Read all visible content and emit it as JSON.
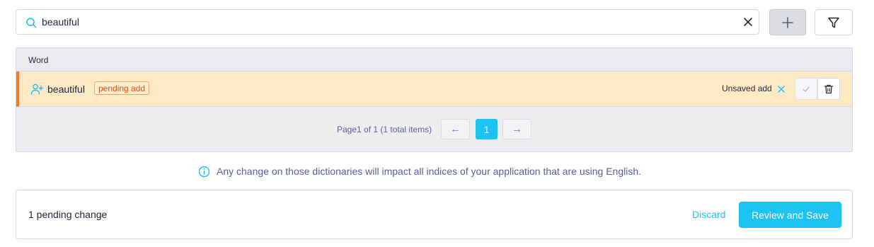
{
  "search": {
    "value": "beautiful",
    "placeholder": ""
  },
  "table": {
    "column_header": "Word",
    "rows": [
      {
        "word": "beautiful",
        "badge": "pending add",
        "status": "Unsaved add"
      }
    ]
  },
  "pagination": {
    "text": "Page1 of 1 (1 total items)",
    "prev_label": "←",
    "current_page": "1",
    "next_label": "→"
  },
  "info": {
    "text": "Any change on those dictionaries will impact all indices of your application that are using English."
  },
  "footer": {
    "pending_text": "1 pending change",
    "discard_label": "Discard",
    "save_label": "Review and Save"
  },
  "colors": {
    "accent": "#1ec2f0",
    "pending_row_bg": "#fde9c4",
    "pending_border": "#f47c28",
    "badge_text": "#d4510f"
  },
  "icons": [
    "search-icon",
    "clear-icon",
    "plus-icon",
    "filter-icon",
    "user-plus-icon",
    "close-icon",
    "check-icon",
    "trash-icon",
    "info-icon"
  ]
}
